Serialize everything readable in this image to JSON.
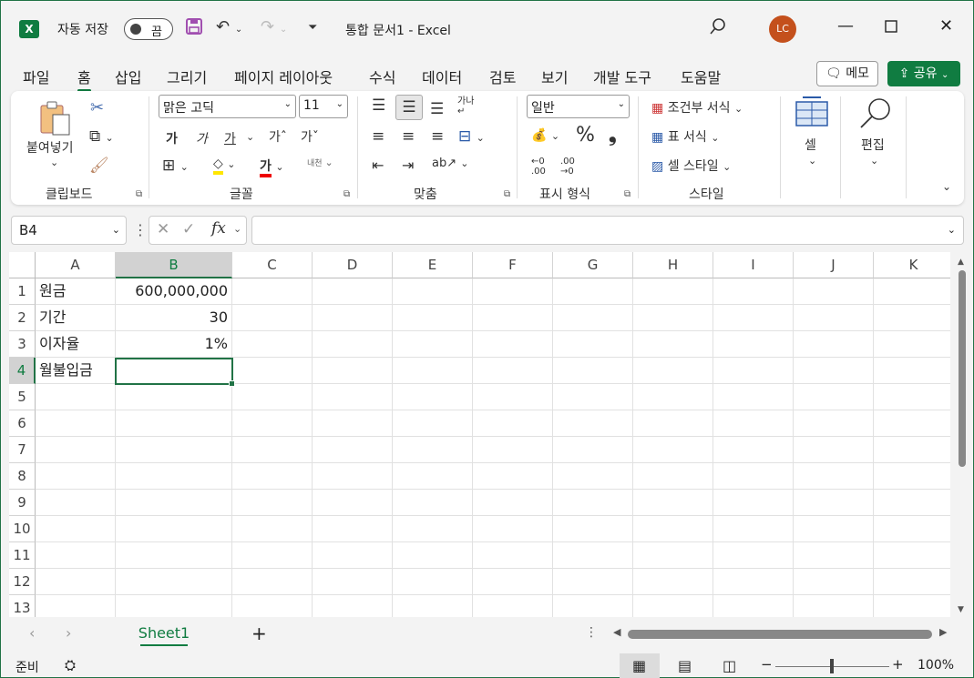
{
  "titlebar": {
    "app_icon": "X",
    "autosave_label": "자동 저장",
    "autosave_state": "끔",
    "doc_title": "통합 문서1  -  Excel",
    "user_initials": "LC"
  },
  "tabs": [
    "파일",
    "홈",
    "삽입",
    "그리기",
    "페이지 레이아웃",
    "수식",
    "데이터",
    "검토",
    "보기",
    "개발 도구",
    "도움말"
  ],
  "active_tab": "홈",
  "actions": {
    "memo": "메모",
    "share": "공유"
  },
  "ribbon": {
    "clipboard": {
      "paste": "붙여넣기",
      "label": "클립보드"
    },
    "font": {
      "name": "맑은 고딕",
      "size": "11",
      "label": "글꼴",
      "bold": "가",
      "italic": "가",
      "underline": "가",
      "grow": "가ˆ",
      "shrink": "가ˇ",
      "fill_glyph": "◇",
      "font_color_glyph": "가",
      "phonetic": "내천"
    },
    "alignment": {
      "label": "맞춤",
      "wrap": "가나",
      "orient": "ab"
    },
    "number": {
      "format": "일반",
      "label": "표시 형식",
      "percent": "%",
      "comma": "❟",
      "inc": "←0\n.00",
      "dec": ".00\n→0"
    },
    "styles": {
      "conditional": "조건부 서식",
      "table": "표 서식",
      "cell_styles": "셀 스타일",
      "label": "스타일"
    },
    "cells": {
      "label": "셀"
    },
    "editing": {
      "label": "편집"
    }
  },
  "formula_bar": {
    "name_box": "B4",
    "fx": "fx",
    "value": ""
  },
  "grid": {
    "columns": [
      "A",
      "B",
      "C",
      "D",
      "E",
      "F",
      "G",
      "H",
      "I",
      "J",
      "K"
    ],
    "rows": [
      "1",
      "2",
      "3",
      "4",
      "5",
      "6",
      "7",
      "8",
      "9",
      "10",
      "11",
      "12",
      "13"
    ],
    "cells": {
      "A1": "원금",
      "B1": "600,000,000",
      "A2": "기간",
      "B2": "30",
      "A3": "이자율",
      "B3": "1%",
      "A4": "월불입금",
      "B4": ""
    },
    "selected_cell": "B4"
  },
  "sheets": [
    "Sheet1"
  ],
  "status": {
    "ready": "준비",
    "zoom": "100%"
  },
  "colors": {
    "accent": "#107c41",
    "avatar": "#c4501c"
  }
}
